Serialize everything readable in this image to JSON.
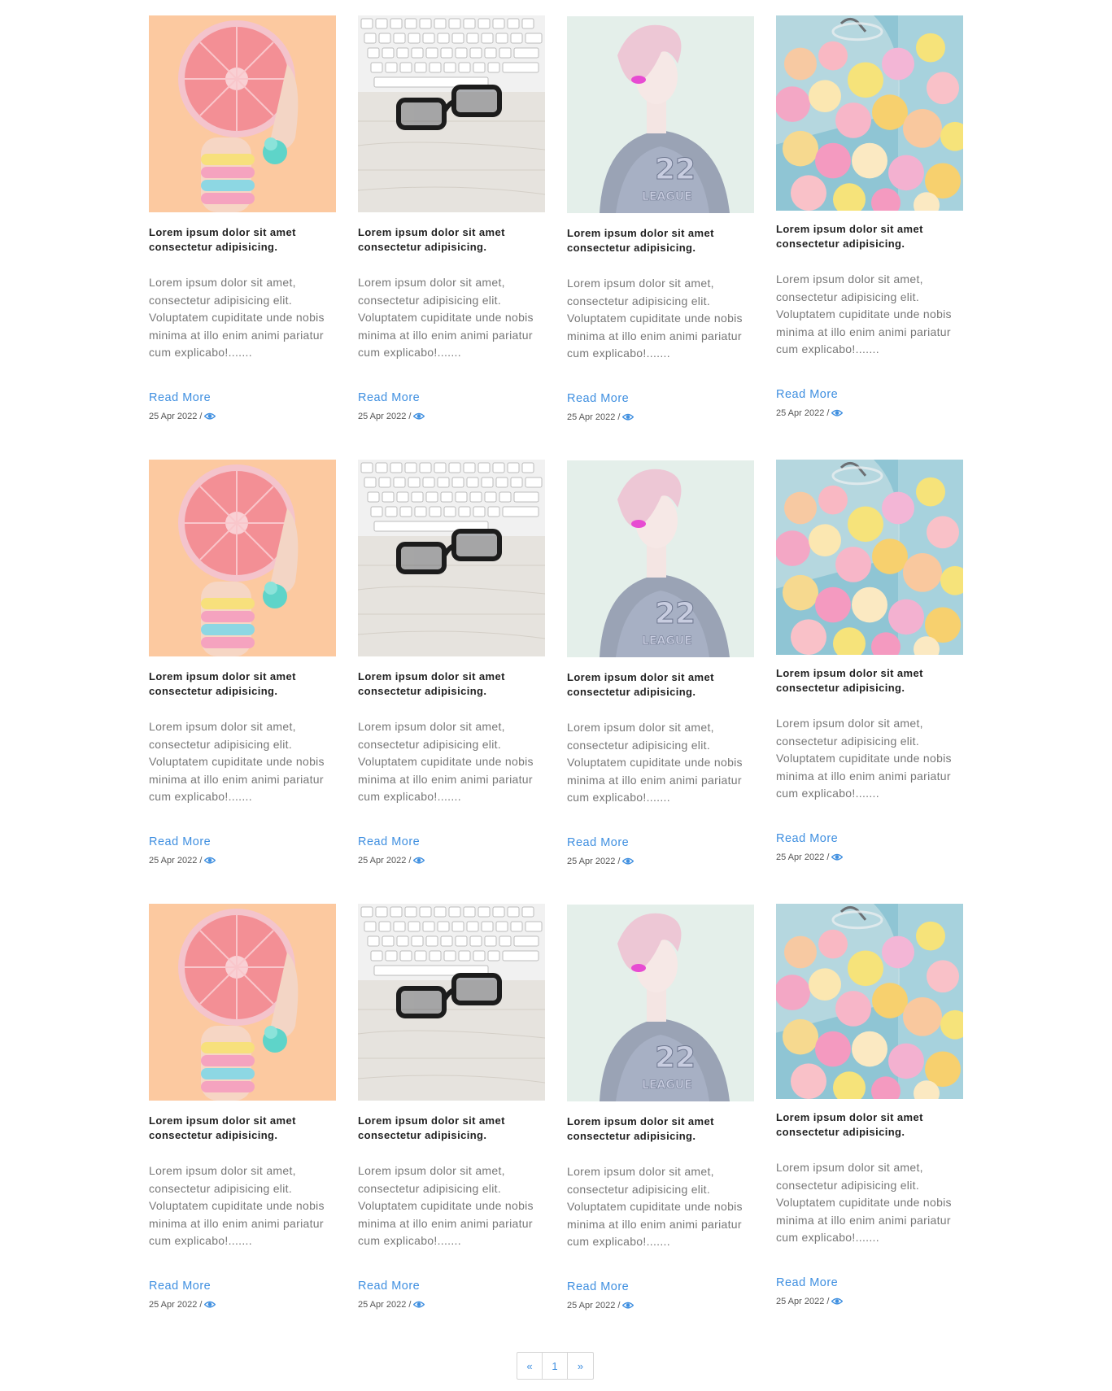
{
  "posts": [
    {
      "image": "grapefruit-photo",
      "title": "Lorem ipsum dolor sit amet consectetur adipisicing.",
      "excerpt": "Lorem ipsum dolor sit amet, consectetur adipisicing elit. Voluptatem cupiditate unde nobis minima at illo enim animi pariatur cum explicabo!.......",
      "read_more": "Read More",
      "date": "25 Apr 2022",
      "separator": "/",
      "icon": "eye-icon"
    },
    {
      "image": "keyboard-glasses-photo",
      "title": "Lorem ipsum dolor sit amet consectetur adipisicing.",
      "excerpt": "Lorem ipsum dolor sit amet, consectetur adipisicing elit. Voluptatem cupiditate unde nobis minima at illo enim animi pariatur cum explicabo!.......",
      "read_more": "Read More",
      "date": "25 Apr 2022",
      "separator": "/",
      "icon": "eye-icon"
    },
    {
      "image": "pink-hair-woman-photo",
      "title": "Lorem ipsum dolor sit amet consectetur adipisicing.",
      "excerpt": "Lorem ipsum dolor sit amet, consectetur adipisicing elit. Voluptatem cupiditate unde nobis minima at illo enim animi pariatur cum explicabo!.......",
      "read_more": "Read More",
      "date": "25 Apr 2022",
      "separator": "/",
      "icon": "eye-icon"
    },
    {
      "image": "candy-jar-photo",
      "title": "Lorem ipsum dolor sit amet consectetur adipisicing.",
      "excerpt": "Lorem ipsum dolor sit amet, consectetur adipisicing elit. Voluptatem cupiditate unde nobis minima at illo enim animi pariatur cum explicabo!.......",
      "read_more": "Read More",
      "date": "25 Apr 2022",
      "separator": "/",
      "icon": "eye-icon"
    },
    {
      "image": "grapefruit-photo",
      "title": "Lorem ipsum dolor sit amet consectetur adipisicing.",
      "excerpt": "Lorem ipsum dolor sit amet, consectetur adipisicing elit. Voluptatem cupiditate unde nobis minima at illo enim animi pariatur cum explicabo!.......",
      "read_more": "Read More",
      "date": "25 Apr 2022",
      "separator": "/",
      "icon": "eye-icon"
    },
    {
      "image": "keyboard-glasses-photo",
      "title": "Lorem ipsum dolor sit amet consectetur adipisicing.",
      "excerpt": "Lorem ipsum dolor sit amet, consectetur adipisicing elit. Voluptatem cupiditate unde nobis minima at illo enim animi pariatur cum explicabo!.......",
      "read_more": "Read More",
      "date": "25 Apr 2022",
      "separator": "/",
      "icon": "eye-icon"
    },
    {
      "image": "pink-hair-woman-photo",
      "title": "Lorem ipsum dolor sit amet consectetur adipisicing.",
      "excerpt": "Lorem ipsum dolor sit amet, consectetur adipisicing elit. Voluptatem cupiditate unde nobis minima at illo enim animi pariatur cum explicabo!.......",
      "read_more": "Read More",
      "date": "25 Apr 2022",
      "separator": "/",
      "icon": "eye-icon"
    },
    {
      "image": "candy-jar-photo",
      "title": "Lorem ipsum dolor sit amet consectetur adipisicing.",
      "excerpt": "Lorem ipsum dolor sit amet, consectetur adipisicing elit. Voluptatem cupiditate unde nobis minima at illo enim animi pariatur cum explicabo!.......",
      "read_more": "Read More",
      "date": "25 Apr 2022",
      "separator": "/",
      "icon": "eye-icon"
    },
    {
      "image": "grapefruit-photo",
      "title": "Lorem ipsum dolor sit amet consectetur adipisicing.",
      "excerpt": "Lorem ipsum dolor sit amet, consectetur adipisicing elit. Voluptatem cupiditate unde nobis minima at illo enim animi pariatur cum explicabo!.......",
      "read_more": "Read More",
      "date": "25 Apr 2022",
      "separator": "/",
      "icon": "eye-icon"
    },
    {
      "image": "keyboard-glasses-photo",
      "title": "Lorem ipsum dolor sit amet consectetur adipisicing.",
      "excerpt": "Lorem ipsum dolor sit amet, consectetur adipisicing elit. Voluptatem cupiditate unde nobis minima at illo enim animi pariatur cum explicabo!.......",
      "read_more": "Read More",
      "date": "25 Apr 2022",
      "separator": "/",
      "icon": "eye-icon"
    },
    {
      "image": "pink-hair-woman-photo",
      "title": "Lorem ipsum dolor sit amet consectetur adipisicing.",
      "excerpt": "Lorem ipsum dolor sit amet, consectetur adipisicing elit. Voluptatem cupiditate unde nobis minima at illo enim animi pariatur cum explicabo!.......",
      "read_more": "Read More",
      "date": "25 Apr 2022",
      "separator": "/",
      "icon": "eye-icon"
    },
    {
      "image": "candy-jar-photo",
      "title": "Lorem ipsum dolor sit amet consectetur adipisicing.",
      "excerpt": "Lorem ipsum dolor sit amet, consectetur adipisicing elit. Voluptatem cupiditate unde nobis minima at illo enim animi pariatur cum explicabo!.......",
      "read_more": "Read More",
      "date": "25 Apr 2022",
      "separator": "/",
      "icon": "eye-icon"
    }
  ],
  "pagination": {
    "prev": "«",
    "current": "1",
    "next": "»"
  },
  "colors": {
    "link": "#3f8fe0",
    "title": "#222222",
    "excerpt": "#777777",
    "border": "#d6d6d6"
  }
}
